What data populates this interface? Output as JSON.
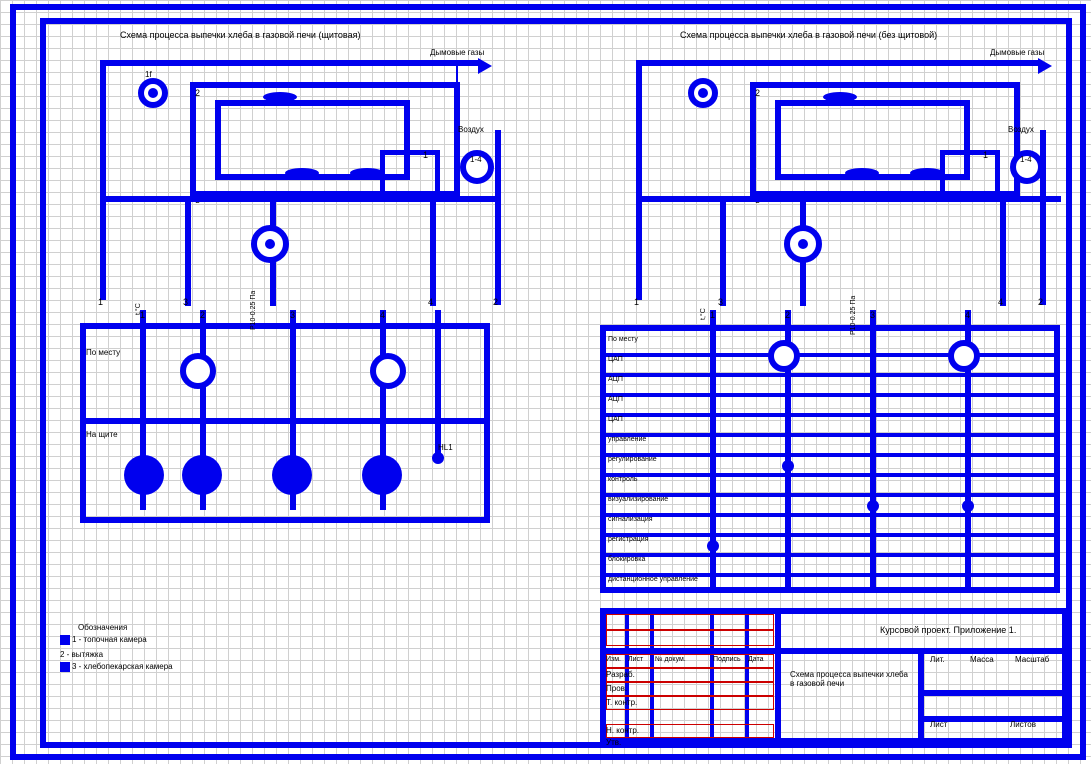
{
  "titles": {
    "left": "Схема процесса выпечки хлеба в газовой печи (щитовая)",
    "right": "Схема процесса выпечки хлеба в газовой печи (без щитовой)"
  },
  "labels": {
    "flue": "Дымовые газы",
    "air": "Воздух",
    "n1": "1",
    "n2": "2",
    "n3": "3",
    "n4": "4",
    "n1_4": "1-4",
    "p": "Р10-0.25 Па",
    "t": "t,°C",
    "pomestu": "По месту",
    "nashite": "На щите",
    "hl": "HL1"
  },
  "left_rows": [
    "По месту",
    "На щите"
  ],
  "right_rows": [
    "По месту",
    "ЦАП",
    "АЦП",
    "АЦП",
    "ЦАП",
    "управление",
    "регулирование",
    "контроль",
    "визуализирование",
    "сигнализация",
    "регистрация",
    "блокировка",
    "дистанционное управление"
  ],
  "legend": {
    "head": "Обозначения",
    "a": "1 - топочная камера",
    "b": "2 - вытяжка",
    "c": "3 - хлебопекарская камера"
  },
  "titleblock": {
    "project": "Курсовой проект. Приложение 1.",
    "desc": "Схема процесса выпечки хлеба в газовой печи",
    "col_lit": "Лит.",
    "col_mass": "Масса",
    "col_scale": "Масштаб",
    "list": "Лист",
    "listov": "Листов",
    "r1": "Изм.",
    "r2": "Лист",
    "r3": "№ докум.",
    "r4": "Подпись",
    "r5": "Дата",
    "p1": "Разраб.",
    "p2": "Пров.",
    "p3": "Т. контр.",
    "p4": "Н. контр.",
    "p5": "Утв."
  }
}
